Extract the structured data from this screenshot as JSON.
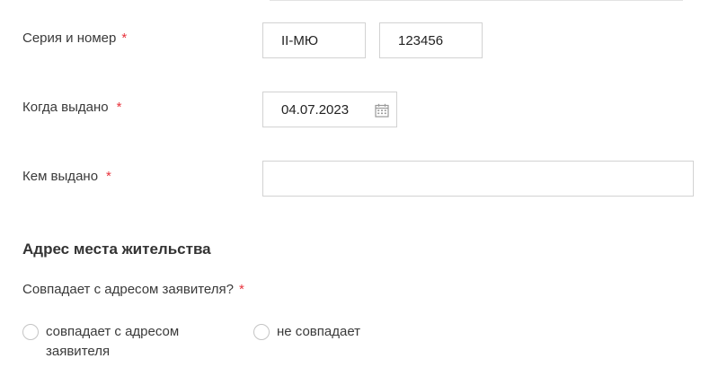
{
  "series_number": {
    "label": "Серия и номер",
    "required_mark": "*",
    "series_value": "II-МЮ",
    "number_value": "123456"
  },
  "issue_date": {
    "label": "Когда выдано",
    "required_mark": "*",
    "value": "04.07.2023",
    "icon": "calendar-icon"
  },
  "issued_by": {
    "label": "Кем выдано",
    "required_mark": "*",
    "value": ""
  },
  "address_section": {
    "title": "Адрес места жительства",
    "question": "Совпадает с адресом заявителя?",
    "required_mark": "*",
    "options": [
      {
        "label": "совпадает с адресом заявителя"
      },
      {
        "label": "не совпадает"
      }
    ]
  },
  "colors": {
    "required": "#e8343d",
    "border": "#d2d2d2",
    "text": "#333333"
  }
}
